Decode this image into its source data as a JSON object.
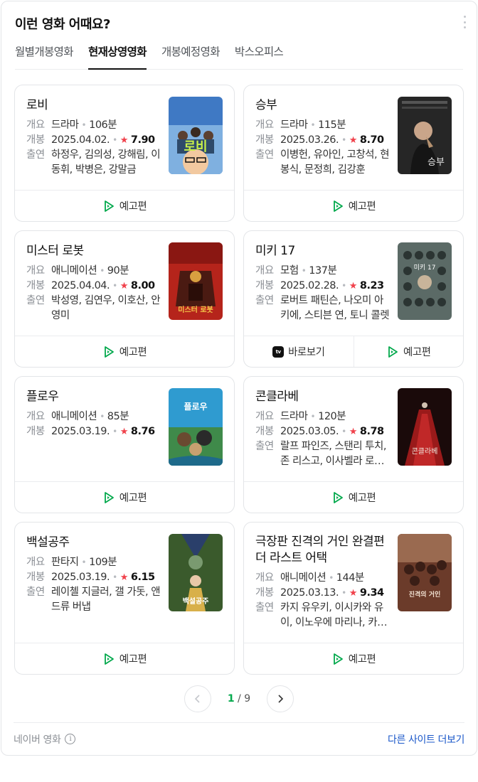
{
  "header": {
    "title": "이런 영화 어때요?",
    "more_icon": "vertical-ellipsis-icon"
  },
  "tabs": [
    {
      "label": "월별개봉영화",
      "active": false
    },
    {
      "label": "현재상영영화",
      "active": true
    },
    {
      "label": "개봉예정영화",
      "active": false
    },
    {
      "label": "박스오피스",
      "active": false
    }
  ],
  "labels": {
    "summary": "개요",
    "release": "개봉",
    "cast": "출연",
    "trailer": "예고편",
    "watch": "바로보기"
  },
  "movies": [
    {
      "title": "로비",
      "genre": "드라마",
      "runtime": "106분",
      "release": "2025.04.02.",
      "rating": "7.90",
      "cast": "하정우, 김의성, 강해림, 이동휘, 박병은, 강말금",
      "poster_color": "#3f79c4"
    },
    {
      "title": "승부",
      "genre": "드라마",
      "runtime": "115분",
      "release": "2025.03.26.",
      "rating": "8.70",
      "cast": "이병헌, 유아인, 고창석, 현봉식, 문정희, 김강훈",
      "poster_color": "#262626"
    },
    {
      "title": "미스터 로봇",
      "genre": "애니메이션",
      "runtime": "90분",
      "release": "2025.04.04.",
      "rating": "8.00",
      "cast": "박성영, 김연우, 이호산, 안영미",
      "poster_color": "#b5241b"
    },
    {
      "title": "미키 17",
      "genre": "모험",
      "runtime": "137분",
      "release": "2025.02.28.",
      "rating": "8.23",
      "cast": "로버트 패틴슨, 나오미 아키에, 스티븐 연, 토니 콜렛",
      "poster_color": "#5b6a66"
    },
    {
      "title": "플로우",
      "genre": "애니메이션",
      "runtime": "85분",
      "release": "2025.03.19.",
      "rating": "8.76",
      "cast": "",
      "poster_color": "#2f9bd0"
    },
    {
      "title": "콘클라베",
      "genre": "드라마",
      "runtime": "120분",
      "release": "2025.03.05.",
      "rating": "8.78",
      "cast": "랄프 파인즈, 스탠리 투치, 존 리스고, 이사벨라 로셀리니",
      "poster_color": "#1a0a0a"
    },
    {
      "title": "백설공주",
      "genre": "판타지",
      "runtime": "109분",
      "release": "2025.03.19.",
      "rating": "6.15",
      "cast": "레이첼 지글러, 갤 가돗, 앤드류 버냅",
      "poster_color": "#3a5a2c"
    },
    {
      "title": "극장판 진격의 거인 완결편 더 라스트 어택",
      "genre": "애니메이션",
      "runtime": "144분",
      "release": "2025.03.13.",
      "rating": "9.34",
      "cast": "카지 유우키, 이시카와 유이, 이노우에 마리나, 카미야 히로시",
      "poster_color": "#6b3b2a"
    }
  ],
  "poster_text": [
    "로비",
    "승부",
    "미스터 로봇",
    "미키 17",
    "플로우",
    "콘클라베",
    "백설공주",
    "진격의 거인"
  ],
  "pagination": {
    "current": "1",
    "separator": "/",
    "total": "9"
  },
  "footer": {
    "source": "네이버 영화",
    "info": "i",
    "more_link": "다른 사이트 더보기"
  },
  "colors": {
    "accent_green": "#03a94d",
    "star_red": "#f0414b",
    "link_blue": "#1a57c9"
  }
}
